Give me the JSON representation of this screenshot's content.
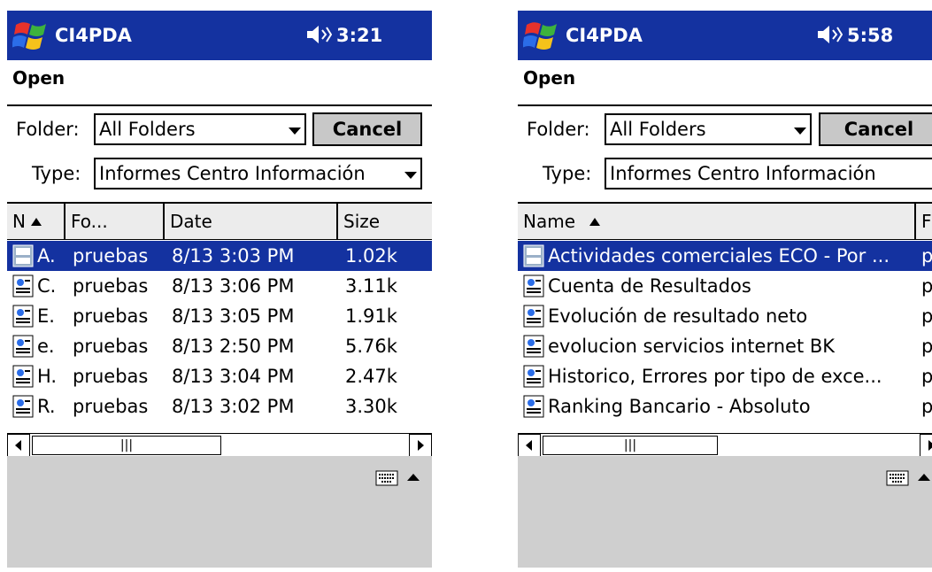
{
  "screens": [
    {
      "title_bar": {
        "app_name": "CI4PDA",
        "time": "3:21"
      },
      "dialog_title": "Open",
      "folder": {
        "label": "Folder:",
        "value": "All Folders"
      },
      "cancel_label": "Cancel",
      "type": {
        "label": "Type:",
        "value": "Informes Centro Información"
      },
      "columns": [
        "N",
        "Fo...",
        "Date",
        "Size"
      ],
      "rows": [
        {
          "name": "A.",
          "folder": "pruebas",
          "date": "8/13 3:03 PM",
          "size": "1.02k",
          "selected": true
        },
        {
          "name": "C.",
          "folder": "pruebas",
          "date": "8/13 3:06 PM",
          "size": "3.11k",
          "selected": false
        },
        {
          "name": "E.",
          "folder": "pruebas",
          "date": "8/13 3:05 PM",
          "size": "1.91k",
          "selected": false
        },
        {
          "name": "e.",
          "folder": "pruebas",
          "date": "8/13 2:50 PM",
          "size": "5.76k",
          "selected": false
        },
        {
          "name": "H.",
          "folder": "pruebas",
          "date": "8/13 3:04 PM",
          "size": "2.47k",
          "selected": false
        },
        {
          "name": "R.",
          "folder": "pruebas",
          "date": "8/13 3:02 PM",
          "size": "3.30k",
          "selected": false
        }
      ],
      "scroll_thumb": "|||"
    },
    {
      "title_bar": {
        "app_name": "CI4PDA",
        "time": "5:58"
      },
      "dialog_title": "Open",
      "folder": {
        "label": "Folder:",
        "value": "All Folders"
      },
      "cancel_label": "Cancel",
      "type": {
        "label": "Type:",
        "value": "Informes Centro Información"
      },
      "columns": [
        "Name",
        "F"
      ],
      "rows": [
        {
          "name": "Actividades comerciales ECO - Por ...",
          "folder": "p",
          "selected": true
        },
        {
          "name": "Cuenta de Resultados",
          "folder": "p",
          "selected": false
        },
        {
          "name": "Evolución de resultado neto",
          "folder": "p",
          "selected": false
        },
        {
          "name": "evolucion servicios internet BK",
          "folder": "p",
          "selected": false
        },
        {
          "name": "Historico, Errores por tipo de exce...",
          "folder": "p",
          "selected": false
        },
        {
          "name": "Ranking Bancario - Absoluto",
          "folder": "p",
          "selected": false
        }
      ],
      "scroll_thumb": "|||"
    }
  ],
  "colors": {
    "title_bar": "#1432a0",
    "selection": "#1432a0",
    "bottom_bar": "#cfcfcf"
  },
  "icons": [
    "windows-logo-icon",
    "speaker-icon",
    "document-icon",
    "keyboard-icon"
  ]
}
